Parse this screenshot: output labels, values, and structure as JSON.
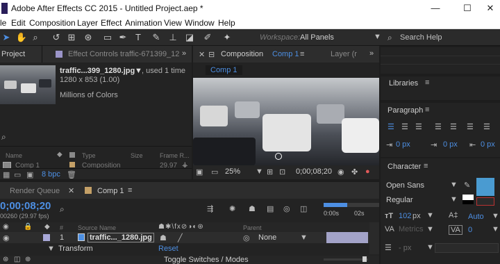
{
  "window": {
    "title": "Adobe After Effects CC 2015 - Untitled Project.aep *",
    "minimize": "—",
    "maximize": "☐",
    "close": "✕"
  },
  "menu": [
    "le",
    "Edit",
    "Composition",
    "Layer",
    "Effect",
    "Animation",
    "View",
    "Window",
    "Help"
  ],
  "toolbar": {
    "workspace_label": "Workspace:",
    "workspace_value": "All Panels",
    "search_help": "Search Help"
  },
  "project": {
    "tab": "Project",
    "effect_controls_tab": "Effect Controls traffic-671399_12",
    "asset_name": "traffic...399_1280.jpg",
    "asset_used": ", used 1 time",
    "asset_size": "1280 x 853 (1.00)",
    "asset_colors": "Millions of Colors",
    "search_placeholder": "",
    "col_name": "Name",
    "col_type": "Type",
    "col_size": "Size",
    "col_frame": "Frame R...",
    "row_name": "Comp 1",
    "row_type": "Composition",
    "row_frame": "29.97",
    "bpc": "8 bpc"
  },
  "composition": {
    "tab": "Composition",
    "tab_comp": "Comp 1",
    "layer_tab": "Layer (r",
    "comp_button": "Comp 1",
    "zoom": "25%",
    "timecode": "0;00;08;20"
  },
  "right_panels": {
    "libraries": "Libraries",
    "paragraph": "Paragraph",
    "indent_left": "0 px",
    "indent_first": "0 px",
    "indent_right": "0 px",
    "character": "Character",
    "font_family": "Open Sans",
    "font_style": "Regular",
    "font_size": "102",
    "font_size_unit": "px",
    "leading": "Auto",
    "kerning": "Metrics",
    "tracking": "0",
    "stroke_width": "- px"
  },
  "timeline": {
    "render_queue_tab": "Render Queue",
    "comp_tab": "Comp 1",
    "timecode": "0;00;08;20",
    "frames": "00260 (29.97 fps)",
    "col_num": "#",
    "col_source": "Source Name",
    "col_parent": "Parent",
    "layer_num": "1",
    "layer_name": "traffic..._1280.jpg",
    "parent_value": "None",
    "transform": "Transform",
    "reset": "Reset",
    "toggle": "Toggle Switches / Modes",
    "ruler_0": "0:00s",
    "ruler_2": "02s"
  },
  "colors": {
    "accent_blue": "#4d8fe3",
    "fill_swatch": "#4a9bd1",
    "layer_label": "#a8a8d8"
  }
}
